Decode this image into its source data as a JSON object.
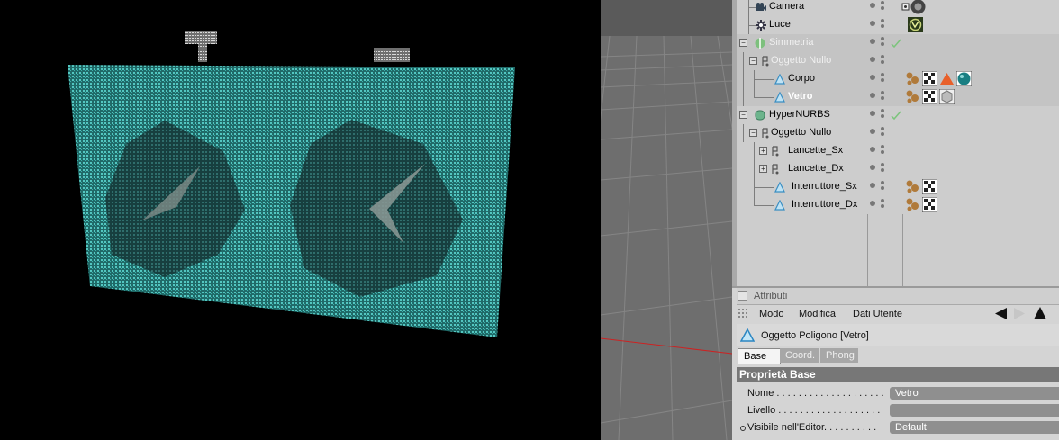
{
  "object_manager": {
    "objects": [
      {
        "name": "Camera",
        "icon": "camera-icon",
        "style": "normal",
        "selected": false
      },
      {
        "name": "Luce",
        "icon": "light-icon",
        "style": "normal",
        "selected": false
      },
      {
        "name": "Simmetria",
        "icon": "symmetry-icon",
        "style": "dim",
        "selected": true
      },
      {
        "name": "Oggetto Nullo",
        "icon": "null-icon",
        "style": "dim",
        "selected": true
      },
      {
        "name": "Corpo",
        "icon": "polygon-icon",
        "style": "normal",
        "selected": true
      },
      {
        "name": "Vetro",
        "icon": "polygon-icon",
        "style": "bold",
        "selected": true
      },
      {
        "name": "HyperNURBS",
        "icon": "hypernurbs-icon",
        "style": "normal",
        "selected": false
      },
      {
        "name": "Oggetto Nullo",
        "icon": "null-icon",
        "style": "normal",
        "selected": false
      },
      {
        "name": "Lancette_Sx",
        "icon": "null-icon",
        "style": "normal",
        "selected": false
      },
      {
        "name": "Lancette_Dx",
        "icon": "null-icon",
        "style": "normal",
        "selected": false
      },
      {
        "name": "Interruttore_Sx",
        "icon": "polygon-icon",
        "style": "normal",
        "selected": false
      },
      {
        "name": "Interruttore_Dx",
        "icon": "polygon-icon",
        "style": "normal",
        "selected": false
      }
    ]
  },
  "attributes": {
    "title": "Attributi",
    "menu": [
      "Modo",
      "Modifica",
      "Dati Utente"
    ],
    "object_label": "Oggetto Poligono [Vetro]",
    "tabs": [
      "Base",
      "Coord.",
      "Phong"
    ],
    "active_tab": "Base",
    "section_title": "Proprietà Base",
    "fields": {
      "nome_label": "Nome . . . . . . . . . . . . . . . . . . . .",
      "nome_value": "Vetro",
      "livello_label": "Livello . . . . . . . . . . . . . . . . . . .",
      "livello_value": "",
      "visibile_label": "Visibile nell'Editor. . . . . . . . . .",
      "visibile_value": "Default"
    }
  },
  "colors": {
    "render_cyan": "#3aa9a4",
    "selection_row": "#c4c4c4",
    "panel_bg": "#d9d9d9",
    "header_bar": "#777777"
  }
}
